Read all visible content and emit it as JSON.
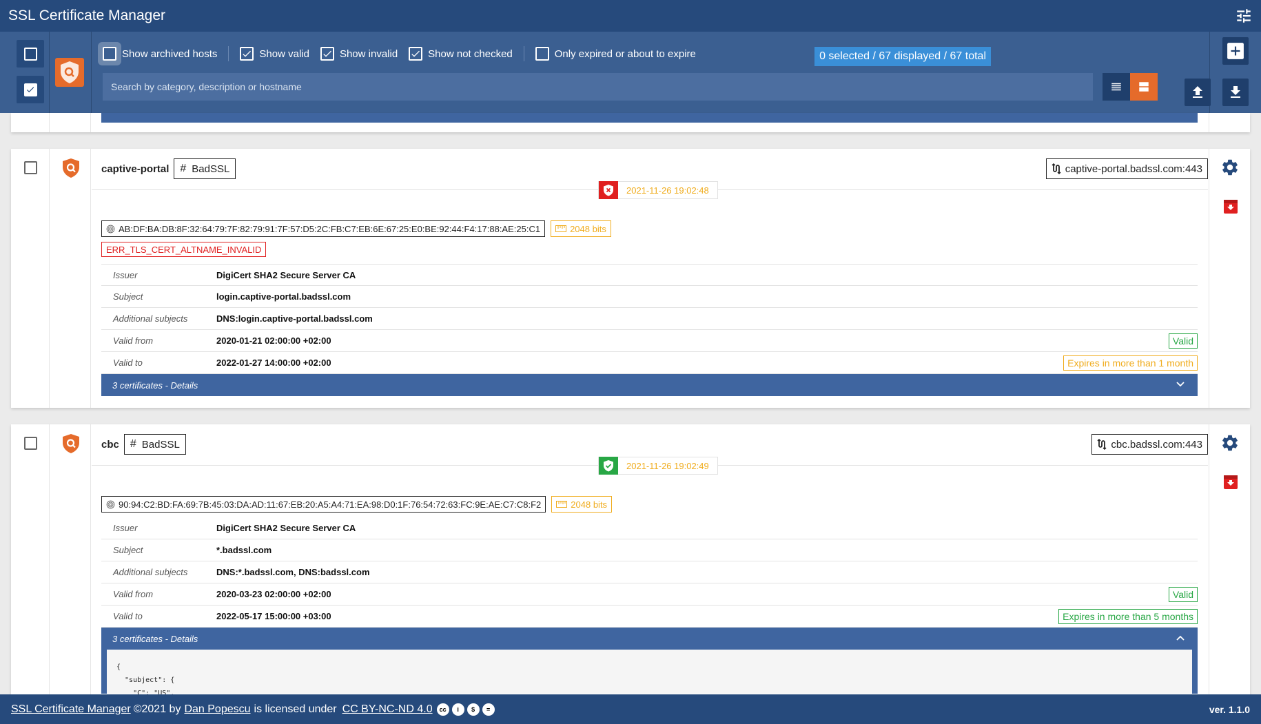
{
  "app": {
    "title": "SSL Certificate Manager"
  },
  "toolbar": {
    "filters": [
      {
        "label": "Show archived hosts",
        "checked": false
      },
      {
        "label": "Show valid",
        "checked": true
      },
      {
        "label": "Show invalid",
        "checked": true
      },
      {
        "label": "Show not checked",
        "checked": true
      },
      {
        "label": "Only expired or about to expire",
        "checked": false
      }
    ],
    "count_label": "0 selected / 67 displayed / 67 total",
    "search_placeholder": "Search by category, description or hostname"
  },
  "hosts": [
    {
      "name": "captive-portal",
      "category": "BadSSL",
      "address": "captive-portal.badssl.com:443",
      "status": "invalid",
      "checked_at": "2021-11-26 19:02:48",
      "fingerprint": "AB:DF:BA:DB:8F:32:64:79:7F:82:79:91:7F:57:D5:2C:FB:C7:EB:6E:67:25:E0:BE:92:44:F4:17:88:AE:25:C1",
      "key_size": "2048 bits",
      "error": "ERR_TLS_CERT_ALTNAME_INVALID",
      "details": [
        {
          "label": "Issuer",
          "value": "DigiCert SHA2 Secure Server CA"
        },
        {
          "label": "Subject",
          "value": "login.captive-portal.badssl.com"
        },
        {
          "label": "Additional subjects",
          "value": "DNS:login.captive-portal.badssl.com"
        },
        {
          "label": "Valid from",
          "value": "2020-01-21 02:00:00 +02:00",
          "badge": "Valid"
        },
        {
          "label": "Valid to",
          "value": "2022-01-27 14:00:00 +02:00",
          "badge": "Expires in more than 1 month"
        }
      ],
      "chain_label": "3 certificates - Details"
    },
    {
      "name": "cbc",
      "category": "BadSSL",
      "address": "cbc.badssl.com:443",
      "status": "valid",
      "checked_at": "2021-11-26 19:02:49",
      "fingerprint": "90:94:C2:BD:FA:69:7B:45:03:DA:AD:11:67:EB:20:A5:A4:71:EA:98:D0:1F:76:54:72:63:FC:9E:AE:C7:C8:F2",
      "key_size": "2048 bits",
      "details": [
        {
          "label": "Issuer",
          "value": "DigiCert SHA2 Secure Server CA"
        },
        {
          "label": "Subject",
          "value": "*.badssl.com"
        },
        {
          "label": "Additional subjects",
          "value": "DNS:*.badssl.com, DNS:badssl.com"
        },
        {
          "label": "Valid from",
          "value": "2020-03-23 02:00:00 +02:00",
          "badge": "Valid"
        },
        {
          "label": "Valid to",
          "value": "2022-05-17 15:00:00 +03:00",
          "badge": "Expires in more than 5 months"
        }
      ],
      "chain_label": "3 certificates - Details",
      "chain_json": "{\n  \"subject\": {\n    \"C\": \"US\","
    }
  ],
  "footer": {
    "product_link": "SSL Certificate Manager",
    "year_by": "©2021 by",
    "author_link": "Dan Popescu",
    "licensed_text": "is licensed under",
    "license_link": "CC BY-NC-ND 4.0",
    "version": "ver. 1.1.0"
  },
  "colors": {
    "header": "#264a7c",
    "toolbar": "#3b5f91",
    "accent_orange": "#e56b2b",
    "valid_green": "#28a745",
    "warn_yellow": "#f0ac1d",
    "error_red": "#e02020"
  }
}
